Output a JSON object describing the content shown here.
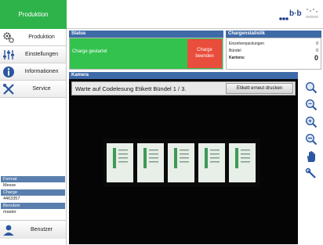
{
  "header": {
    "title": "Produktion",
    "logo_text": "b·b"
  },
  "sidebar": {
    "items": [
      {
        "label": "Produktion",
        "icon": "gears-icon"
      },
      {
        "label": "Einstellungen",
        "icon": "sliders-icon"
      },
      {
        "label": "Informationen",
        "icon": "info-icon"
      },
      {
        "label": "Service",
        "icon": "tools-icon"
      }
    ],
    "info": [
      {
        "label": "Format",
        "value": "Messe"
      },
      {
        "label": "Charge",
        "value": "4463357"
      },
      {
        "label": "Benutzer",
        "value": "master"
      }
    ],
    "user_button": "Benutzer"
  },
  "status": {
    "header": "Status",
    "message": "Charge gestartet",
    "end_button": "Charge beenden",
    "colors": {
      "ok": "#33c24d",
      "end": "#e94d3b"
    }
  },
  "stats": {
    "header": "Chargenstatistik",
    "rows": [
      {
        "label": "Einzelverpackungen",
        "value": "0"
      },
      {
        "label": "Bündel",
        "value": "0"
      },
      {
        "label": "Kartons:",
        "value": "0"
      }
    ]
  },
  "camera": {
    "header": "Kamera",
    "message": "Warte auf Codelesung Etikett Bündel 1 / 3.",
    "reprint_button": "Etikett erneut drucken",
    "package_count": 5
  },
  "tools": [
    "zoom-in-icon",
    "zoom-out-icon",
    "zoom-plus-icon",
    "zoom-minus-icon",
    "hand-pan-icon",
    "wrench-icon"
  ]
}
